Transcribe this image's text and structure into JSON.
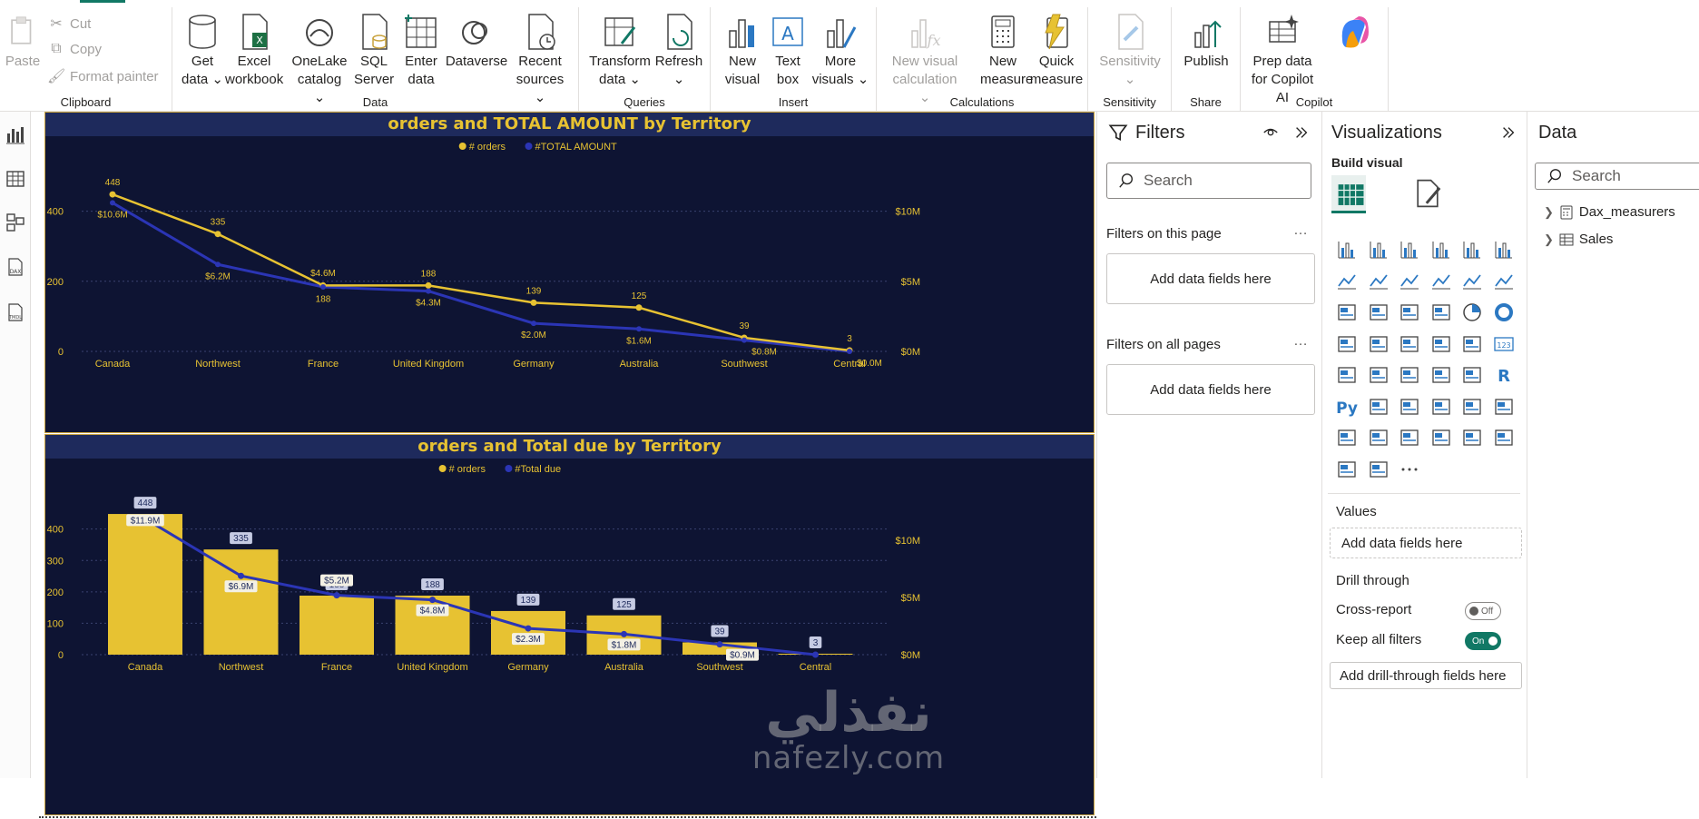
{
  "ribbon": {
    "clipboard": {
      "label": "Clipboard",
      "paste": "Paste",
      "cut": "Cut",
      "copy": "Copy",
      "format_painter": "Format painter"
    },
    "data": {
      "label": "Data",
      "get_data": "Get data",
      "excel": "Excel workbook",
      "onelake": "OneLake catalog",
      "sql": "SQL Server",
      "enter_data": "Enter data",
      "dataverse": "Dataverse",
      "recent": "Recent sources"
    },
    "queries": {
      "label": "Queries",
      "transform": "Transform data",
      "refresh": "Refresh"
    },
    "insert": {
      "label": "Insert",
      "new_visual": "New visual",
      "text_box": "Text box",
      "more_visuals": "More visuals"
    },
    "calculations": {
      "label": "Calculations",
      "new_visual_calc": "New visual calculation",
      "new_measure": "New measure",
      "quick_measure": "Quick measure"
    },
    "sensitivity": {
      "label": "Sensitivity",
      "btn": "Sensitivity"
    },
    "share": {
      "label": "Share",
      "publish": "Publish"
    },
    "copilot": {
      "label": "Copilot",
      "prep": "Prep data for Copilot AI"
    }
  },
  "chart_data": [
    {
      "type": "line",
      "title": "orders and TOTAL AMOUNT by Territory",
      "categories": [
        "Canada",
        "Northwest",
        "France",
        "United Kingdom",
        "Germany",
        "Australia",
        "Southwest",
        "Central"
      ],
      "series": [
        {
          "name": "# orders",
          "axis": "left",
          "values": [
            448,
            335,
            188,
            188,
            139,
            125,
            39,
            3
          ],
          "labels": [
            "448",
            "335",
            "188",
            "188",
            "139",
            "125",
            "39",
            "3"
          ],
          "color": "#e7c232"
        },
        {
          "name": "#TOTAL AMOUNT",
          "axis": "right",
          "values": [
            10.6,
            6.2,
            4.6,
            4.3,
            2.0,
            1.6,
            0.8,
            0.0
          ],
          "labels": [
            "$10.6M",
            "$6.2M",
            "$4.6M",
            "$4.3M",
            "$2.0M",
            "$1.6M",
            "$0.8M",
            "$0.0M"
          ],
          "color": "#2b35b5"
        }
      ],
      "y_left_ticks": [
        "0",
        "200",
        "400"
      ],
      "y_left_lim": [
        0,
        500
      ],
      "y_right_ticks": [
        "$0M",
        "$5M",
        "$10M"
      ],
      "y_right_lim": [
        0,
        12.5
      ],
      "legend": "top-center"
    },
    {
      "type": "bar",
      "title": "orders and Total due by Territory",
      "categories": [
        "Canada",
        "Northwest",
        "France",
        "United Kingdom",
        "Germany",
        "Australia",
        "Southwest",
        "Central"
      ],
      "series": [
        {
          "name": "# orders",
          "axis": "left",
          "kind": "bar",
          "values": [
            448,
            335,
            188,
            188,
            139,
            125,
            39,
            3
          ],
          "labels": [
            "448",
            "335",
            "188",
            "188",
            "139",
            "125",
            "39",
            "3"
          ],
          "color": "#e7c232"
        },
        {
          "name": "#Total due",
          "axis": "right",
          "kind": "line",
          "values": [
            11.9,
            6.9,
            5.2,
            4.8,
            2.3,
            1.8,
            0.9,
            0.0
          ],
          "labels": [
            "$11.9M",
            "$6.9M",
            "$5.2M",
            "$4.8M",
            "$2.3M",
            "$1.8M",
            "$0.9M",
            ""
          ],
          "color": "#2b35b5"
        }
      ],
      "y_left_ticks": [
        "0",
        "100",
        "200",
        "300",
        "400"
      ],
      "y_left_lim": [
        0,
        480
      ],
      "y_right_ticks": [
        "$0M",
        "$5M",
        "$10M"
      ],
      "y_right_lim": [
        0,
        13.2
      ],
      "legend": "top-center"
    }
  ],
  "filters": {
    "title": "Filters",
    "search_placeholder": "Search",
    "on_this_page": "Filters on this page",
    "on_all_pages": "Filters on all pages",
    "add_fields": "Add data fields here"
  },
  "visualizations": {
    "title": "Visualizations",
    "build_visual": "Build visual",
    "values_label": "Values",
    "add_fields": "Add data fields here",
    "drill_through": "Drill through",
    "cross_report": "Cross-report",
    "cross_report_state": "Off",
    "keep_filters": "Keep all filters",
    "keep_filters_state": "On",
    "add_drill": "Add drill-through fields here"
  },
  "data_pane": {
    "title": "Data",
    "search_placeholder": "Search",
    "tables": [
      "Dax_measurers",
      "Sales"
    ]
  },
  "watermark": {
    "arabic": "نفذلي",
    "latin": "nafezly.com"
  },
  "colors": {
    "accent": "#117865",
    "chart_bg": "#0e1433",
    "title_bg": "#1e2a5c",
    "gold": "#e7c232",
    "blue": "#2b35b5"
  }
}
